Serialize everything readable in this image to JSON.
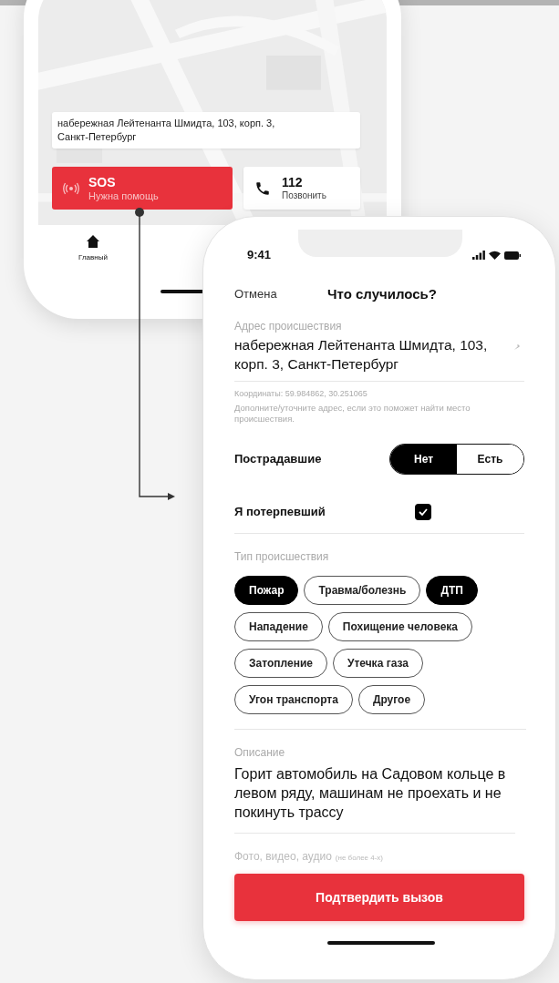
{
  "back_phone": {
    "address": "набережная Лейтенанта Шмидта, 103, корп. 3, Санкт-Петербург",
    "sos": {
      "title": "SOS",
      "subtitle": "Нужна помощь"
    },
    "call": {
      "number": "112",
      "label": "Позвонить"
    },
    "tabs": [
      {
        "label": "Главный",
        "selected": true
      }
    ]
  },
  "front_phone": {
    "time": "9:41",
    "cancel": "Отмена",
    "title": "Что случилось?",
    "address_label": "Адрес происшествия",
    "address": "набережная Лейтенанта Шмидта, 103, корп. 3, Санкт-Петербург",
    "coordinates": "Координаты: 59.984862, 30.251065",
    "hint": "Дополните/уточните адрес, если это поможет найти место происшествия.",
    "victims": {
      "label": "Пострадавшие",
      "options": [
        {
          "label": "Нет",
          "selected": true
        },
        {
          "label": "Есть",
          "selected": false
        }
      ]
    },
    "self_victim": {
      "label": "Я потерпевший",
      "checked": true
    },
    "type_label": "Тип происшествия",
    "types": [
      {
        "label": "Пожар",
        "selected": true
      },
      {
        "label": "Травма/болезнь",
        "selected": false
      },
      {
        "label": "ДТП",
        "selected": true
      },
      {
        "label": "Нападение",
        "selected": false
      },
      {
        "label": "Похищение человека",
        "selected": false
      },
      {
        "label": "Затопление",
        "selected": false
      },
      {
        "label": "Утечка газа",
        "selected": false
      },
      {
        "label": "Угон транспорта",
        "selected": false
      },
      {
        "label": "Другое",
        "selected": false
      }
    ],
    "description_label": "Описание",
    "description": "Горит автомобиль на Садовом кольце в левом ряду, машинам не проехать и не покинуть трассу",
    "media_label": "Фото, видео, аудио",
    "media_note": "(не более 4-х)",
    "submit": "Подтвердить вызов"
  }
}
